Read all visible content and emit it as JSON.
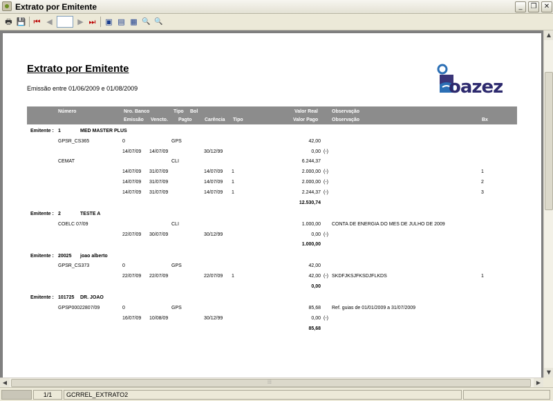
{
  "window": {
    "title": "Extrato por Emitente"
  },
  "window_buttons": {
    "minimize": "_",
    "maximize": "❐",
    "close": "✕"
  },
  "toolbar": {
    "print_glyph": "🖶",
    "save_glyph": "💾",
    "first_glyph": "⏮",
    "prev_glyph": "◀",
    "page_value": "",
    "next_glyph": "▶",
    "last_glyph": "⏭",
    "view1_glyph": "▣",
    "view2_glyph": "▤",
    "view3_glyph": "▦",
    "zoom_in_glyph": "🔍",
    "zoom_out_glyph": "🔍"
  },
  "report": {
    "title": "Extrato por Emitente",
    "subtitle": "Emissão entre 01/06/2009 e 01/08/2009",
    "logo_text": "oazez",
    "header_row1": {
      "numero": "Número",
      "nro_banco": "Nro. Banco",
      "tipo": "Tipo",
      "bol": "Bol",
      "valor_real": "Valor Real",
      "observacao": "Observação"
    },
    "header_row2": {
      "emissao": "Emissão",
      "vencto": "Vencto.",
      "pagto": "Pagto",
      "carencia": "Carência",
      "tipo": "Tipo",
      "valor_pago": "Valor Pago",
      "observacao": "Observação",
      "bx": "Bx"
    },
    "groups": [
      {
        "label": "Emitente :",
        "code": "1",
        "name": "MED MASTER PLUS",
        "docs": [
          {
            "numero": "GPSR_CS365",
            "nro_banco": "0",
            "tipo": "GPS",
            "valor_real": "42,00",
            "obs": "",
            "lines": [
              {
                "emissao": "14/07/09",
                "vencto": "14/07/09",
                "pagto": "",
                "carencia": "30/12/99",
                "tipo": "",
                "valor_pago": "0,00",
                "sign": "(-)",
                "obs": "",
                "bx": ""
              }
            ]
          },
          {
            "numero": "CEMAT",
            "nro_banco": "",
            "tipo": "CLI",
            "valor_real": "6.244,37",
            "obs": "",
            "lines": [
              {
                "emissao": "14/07/09",
                "vencto": "31/07/09",
                "pagto": "",
                "carencia": "14/07/09",
                "tipo": "1",
                "valor_pago": "2.000,00",
                "sign": "(-)",
                "obs": "",
                "bx": "1"
              },
              {
                "emissao": "14/07/09",
                "vencto": "31/07/09",
                "pagto": "",
                "carencia": "14/07/09",
                "tipo": "1",
                "valor_pago": "2.000,00",
                "sign": "(-)",
                "obs": "",
                "bx": "2"
              },
              {
                "emissao": "14/07/09",
                "vencto": "31/07/09",
                "pagto": "",
                "carencia": "14/07/09",
                "tipo": "1",
                "valor_pago": "2.244,37",
                "sign": "(-)",
                "obs": "",
                "bx": "3"
              }
            ]
          }
        ],
        "total": "12.530,74"
      },
      {
        "label": "Emitente :",
        "code": "2",
        "name": "TESTE A",
        "docs": [
          {
            "numero": "COELC 07/09",
            "nro_banco": "",
            "tipo": "CLI",
            "valor_real": "1.000,00",
            "obs": "CONTA DE ENERGIA DO MES DE JULHO DE 2009",
            "lines": [
              {
                "emissao": "22/07/09",
                "vencto": "30/07/09",
                "pagto": "",
                "carencia": "30/12/99",
                "tipo": "",
                "valor_pago": "0,00",
                "sign": "(-)",
                "obs": "",
                "bx": ""
              }
            ]
          }
        ],
        "total": "1.000,00"
      },
      {
        "label": "Emitente :",
        "code": "20025",
        "name": "joao alberto",
        "docs": [
          {
            "numero": "GPSR_CS373",
            "nro_banco": "0",
            "tipo": "GPS",
            "valor_real": "42,00",
            "obs": "",
            "lines": [
              {
                "emissao": "22/07/09",
                "vencto": "22/07/09",
                "pagto": "",
                "carencia": "22/07/09",
                "tipo": "1",
                "valor_pago": "42,00",
                "sign": "(-)",
                "obs": "SKDFJKSJFKSDJFLKDS",
                "bx": "1"
              }
            ]
          }
        ],
        "total": "0,00"
      },
      {
        "label": "Emitente :",
        "code": "101725",
        "name": "DR. JOAO",
        "docs": [
          {
            "numero": "GPSP00022807/09",
            "nro_banco": "0",
            "tipo": "GPS",
            "valor_real": "85,68",
            "obs": "Ref. guias de 01/01/2009 a 31/07/2009",
            "lines": [
              {
                "emissao": "16/07/09",
                "vencto": "10/08/09",
                "pagto": "",
                "carencia": "30/12/99",
                "tipo": "",
                "valor_pago": "0,00",
                "sign": "(-)",
                "obs": "",
                "bx": ""
              }
            ]
          }
        ],
        "total": "85,68"
      }
    ]
  },
  "scroll": {
    "up": "▲",
    "down": "▼",
    "left": "◀",
    "right": "▶",
    "grip": "⁞⁞⁞"
  },
  "status": {
    "page": "1/1",
    "report_id": "GCRREL_EXTRATO2"
  }
}
